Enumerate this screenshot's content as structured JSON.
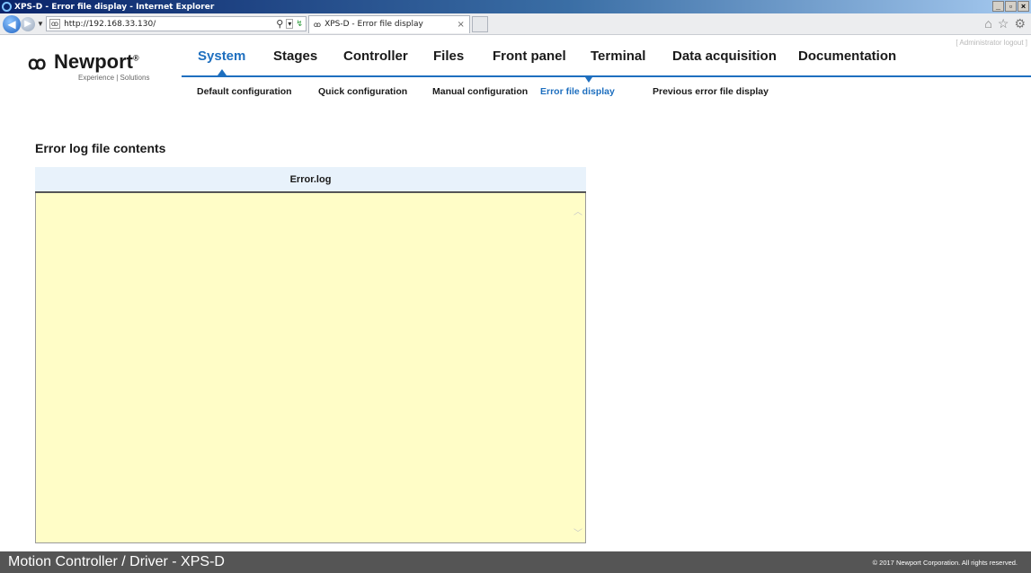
{
  "browser": {
    "window_title": "XPS-D - Error file display - Internet Explorer",
    "url": "http://192.168.33.130/",
    "tab_title": "XPS-D - Error file display",
    "tab_close": "×",
    "favicon": "ꝏ"
  },
  "header": {
    "logo_mark": "ꝏ",
    "brand": "Newport",
    "brand_mark": "®",
    "tagline": "Experience | Solutions",
    "admin_logout": "[ Administrator logout ]"
  },
  "main_nav": [
    {
      "label": "System",
      "active": true
    },
    {
      "label": "Stages"
    },
    {
      "label": "Controller"
    },
    {
      "label": "Files"
    },
    {
      "label": "Front panel"
    },
    {
      "label": "Terminal"
    },
    {
      "label": "Data acquisition"
    },
    {
      "label": "Documentation"
    }
  ],
  "sub_nav": [
    {
      "label": "Default configuration"
    },
    {
      "label": "Quick configuration"
    },
    {
      "label": "Manual configuration"
    },
    {
      "label": "Error file display",
      "active": true
    },
    {
      "label": "Previous error file display"
    }
  ],
  "content": {
    "section_title": "Error log file contents",
    "log_header": "Error.log",
    "log_text": ""
  },
  "footer": {
    "product": "Motion Controller / Driver - XPS-D",
    "copyright": "© 2017 Newport Corporation. All rights reserved."
  },
  "colors": {
    "accent": "#1e6fbf",
    "log_background": "#fffdc7",
    "log_header_background": "#e8f2fb",
    "footer_background": "#555555"
  }
}
